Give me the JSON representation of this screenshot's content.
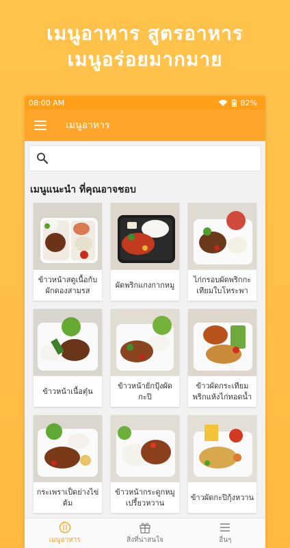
{
  "promo": {
    "line1": "เมนูอาหาร สูตรอาหาร",
    "line2": "เมนูอร่อยมากมาย"
  },
  "statusbar": {
    "time": "08:00 AM",
    "battery": "82%"
  },
  "appbar": {
    "title": "เมนูอาหาร"
  },
  "search": {
    "placeholder": ""
  },
  "section": {
    "title": "เมนูแนะนำ ที่คุณอาจชอบ"
  },
  "menu_items": [
    {
      "label": "ข้าวหน้าสตูเนื้อกับผักดองสามรส",
      "icon": "food-photo"
    },
    {
      "label": "ผัดพริกแกงกากหมู",
      "icon": "food-photo"
    },
    {
      "label": "ไก่กรอบผัดพริกกะเทียมใบโหระพา",
      "icon": "food-photo"
    },
    {
      "label": "ข้าวหน้าเนื้อตุ๋น",
      "icon": "food-photo"
    },
    {
      "label": "ข้าวหน้ายักปุ้งผัดกะปิ",
      "icon": "food-photo"
    },
    {
      "label": "ข้าวผัดกระเทียมพริกแห้งไก่ทอดน้ำ",
      "icon": "food-photo"
    },
    {
      "label": "กระเพราเป็ดย่างไข่ต้ม",
      "icon": "food-photo"
    },
    {
      "label": "ข้าวหน้ากระดูกหมูเปรี้ยวหวาน",
      "icon": "food-photo"
    },
    {
      "label": "ข้าวผัดกะปิกุ้งหวาน",
      "icon": "food-photo"
    }
  ],
  "bottom_nav": [
    {
      "label": "เมนูอาหาร",
      "icon": "food-icon",
      "active": true
    },
    {
      "label": "สิ่งที่น่าสนใจ",
      "icon": "gift-icon",
      "active": false
    },
    {
      "label": "อื่นๆ",
      "icon": "menu-icon",
      "active": false
    }
  ],
  "colors": {
    "accent": "#ffa52a",
    "statusbar": "#ff9f1a",
    "background": "#ffc24a"
  }
}
